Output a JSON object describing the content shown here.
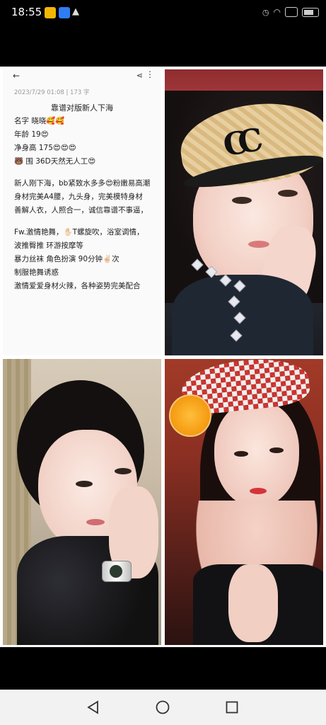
{
  "status_bar": {
    "time": "18:55"
  },
  "note": {
    "meta": "2023/7/29 01:08  |  173 字",
    "title": "靠谱对版新人下海",
    "lines": [
      "名字   晓晓🥰🥰",
      "年龄      19😍",
      "净身高   175😍😍😍",
      "🐻 围       36D天然无人工😍",
      "",
      "新人刚下海，bb紧致水多多😍粉嫩易高潮",
      "身材完美A4腰，九头身，完美模特身材",
      "善解人衣，人照合一，诚信靠谱不事逼，",
      "",
      "Fw.激情艳舞，✋🏻T螺旋吹，浴室调情，",
      "   波推臀推    环游按摩等",
      "暴力丝袜   角色扮演    90分钟✌🏻次",
      "制服艳舞诱惑",
      "激情爱爱身材火辣，各种姿势完美配合"
    ]
  },
  "photos": {
    "photo1": {
      "logo_text": "CC"
    }
  },
  "colors": {
    "nav_bar_bg": "#f2f2f2",
    "nav_icon": "#333333"
  },
  "icons": {
    "back": "back-arrow-icon",
    "share": "share-icon",
    "more": "more-vertical-icon",
    "nav_back": "triangle-back-icon",
    "nav_home": "circle-home-icon",
    "nav_recent": "square-recents-icon"
  }
}
